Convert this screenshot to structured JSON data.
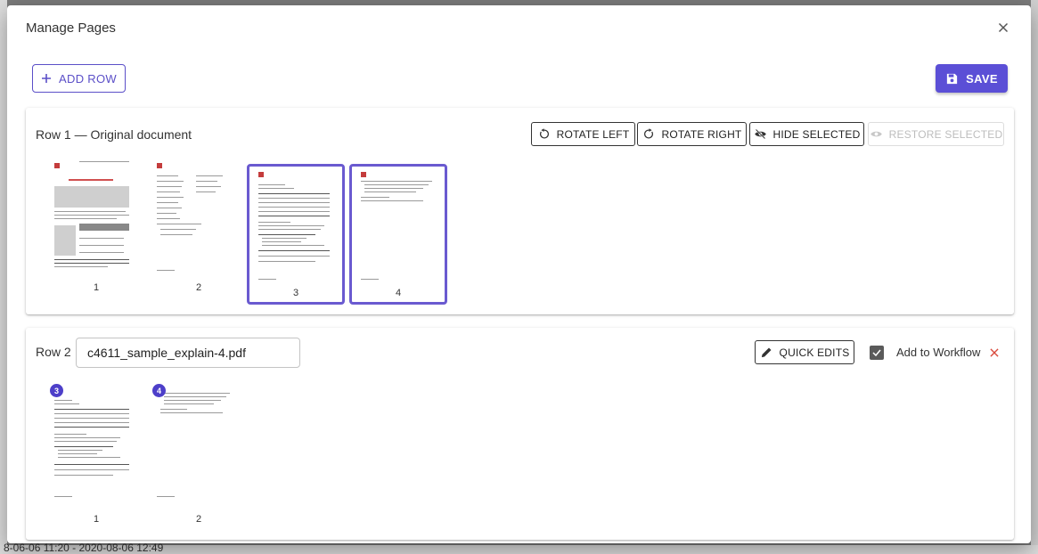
{
  "dialog": {
    "title": "Manage Pages"
  },
  "toolbar": {
    "add_row_label": "ADD ROW",
    "save_label": "SAVE"
  },
  "row1": {
    "title": "Row 1 — Original document",
    "buttons": {
      "rotate_left": "ROTATE LEFT",
      "rotate_right": "ROTATE RIGHT",
      "hide_selected": "HIDE SELECTED",
      "restore_selected": "RESTORE SELECTED"
    },
    "pages": [
      {
        "number": "1",
        "selected": false
      },
      {
        "number": "2",
        "selected": false
      },
      {
        "number": "3",
        "selected": true
      },
      {
        "number": "4",
        "selected": true
      }
    ]
  },
  "row2": {
    "label": "Row 2",
    "filename": "c4611_sample_explain-4.pdf",
    "quick_edits_label": "QUICK EDITS",
    "add_to_workflow_label": "Add to Workflow",
    "add_to_workflow_checked": true,
    "pages": [
      {
        "number": "1",
        "source_badge": "3"
      },
      {
        "number": "2",
        "source_badge": "4"
      }
    ]
  },
  "background": {
    "footer_text": "8-06-06 11:20 - 2020-08-06 12:49"
  },
  "colors": {
    "accent": "#5b4fd6",
    "selected_border": "#6a5ad0",
    "danger": "#d94a3d",
    "badge": "#4d3fc9"
  },
  "icons": {
    "close": "close-icon",
    "add": "plus-icon",
    "save": "floppy-disk-icon",
    "rotate_left": "rotate-left-icon",
    "rotate_right": "rotate-right-icon",
    "hide": "eye-off-icon",
    "restore": "eye-icon",
    "edit": "pencil-icon",
    "check": "check-icon",
    "remove": "close-red-icon"
  }
}
